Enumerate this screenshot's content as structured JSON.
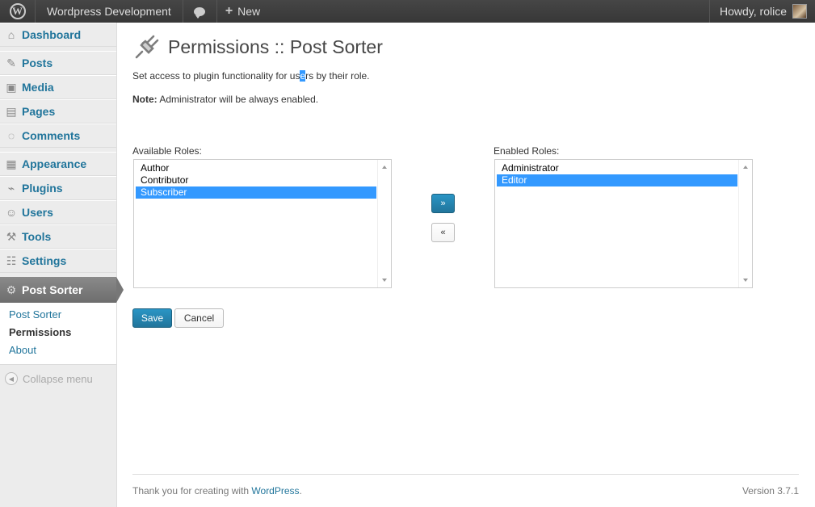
{
  "adminbar": {
    "site_name": "Wordpress Development",
    "new_label": "New",
    "howdy": "Howdy, rolice"
  },
  "sidebar": {
    "items": [
      {
        "label": "Dashboard",
        "icon": "dashboard-icon"
      },
      {
        "label": "Posts",
        "icon": "pin-icon"
      },
      {
        "label": "Media",
        "icon": "media-icon"
      },
      {
        "label": "Pages",
        "icon": "pages-icon"
      },
      {
        "label": "Comments",
        "icon": "comment-icon"
      },
      {
        "label": "Appearance",
        "icon": "appearance-icon"
      },
      {
        "label": "Plugins",
        "icon": "plug-icon"
      },
      {
        "label": "Users",
        "icon": "users-icon"
      },
      {
        "label": "Tools",
        "icon": "tools-icon"
      },
      {
        "label": "Settings",
        "icon": "settings-icon"
      }
    ],
    "current": {
      "label": "Post Sorter",
      "icon": "gear-icon"
    },
    "submenu": [
      "Post Sorter",
      "Permissions",
      "About"
    ],
    "collapse": "Collapse menu"
  },
  "page": {
    "title": "Permissions :: Post Sorter",
    "intro_pre": "Set access to plugin functionality for us",
    "intro_sel": "e",
    "intro_post": "rs by their role.",
    "note_label": "Note:",
    "note_text": " Administrator will be always enabled.",
    "available_label": "Available Roles:",
    "available_roles": [
      "Author",
      "Contributor",
      "Subscriber"
    ],
    "available_selected": "Subscriber",
    "enabled_label": "Enabled Roles:",
    "enabled_roles": [
      "Administrator",
      "Editor"
    ],
    "enabled_selected": "Editor",
    "move_right": "»",
    "move_left": "«",
    "save": "Save",
    "cancel": "Cancel"
  },
  "footer": {
    "thanks": "Thank you for creating with ",
    "wp_link": "WordPress",
    "thanks_end": ".",
    "version": "Version 3.7.1"
  },
  "colors": {
    "accent": "#21759b",
    "selection": "#3399ff",
    "adminbar": "#464646"
  }
}
